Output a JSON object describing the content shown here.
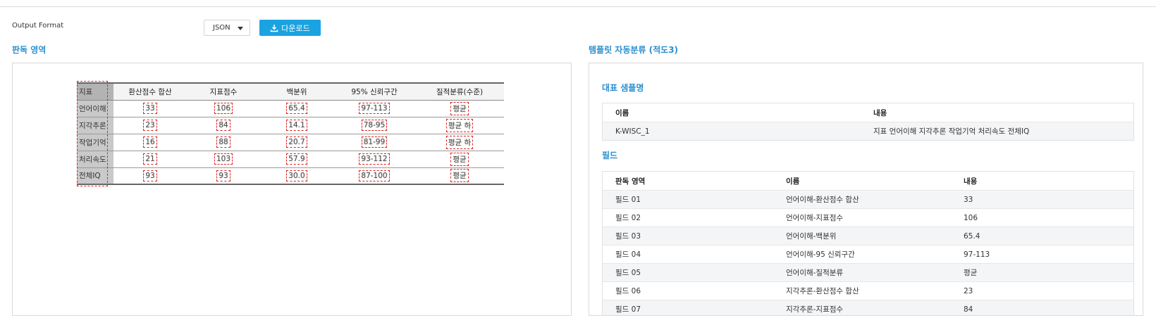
{
  "toolbar": {
    "format_label": "Output Format",
    "format_value": "JSON",
    "download_label": "다운로드"
  },
  "left_panel": {
    "title": "판독 영역",
    "doc_table": {
      "headers": [
        "지표",
        "환산점수 합산",
        "지표점수",
        "백분위",
        "95%  신뢰구간",
        "질적분류(수준)"
      ],
      "rows": [
        [
          "언어이해",
          "33",
          "106",
          "65.4",
          "97-113",
          "평균"
        ],
        [
          "지각추론",
          "23",
          "84",
          "14.1",
          "78-95",
          "평균 하"
        ],
        [
          "작업기억",
          "16",
          "88",
          "20.7",
          "81-99",
          "평균 하"
        ],
        [
          "처리속도",
          "21",
          "103",
          "57.9",
          "93-112",
          "평균"
        ],
        [
          "전체IQ",
          "93",
          "93",
          "30.0",
          "87-100",
          "평균"
        ]
      ]
    }
  },
  "right_panel": {
    "title": "템플릿 자동분류 (적도3)",
    "sample_title": "대표 샘플명",
    "sample_table": {
      "headers": [
        "이름",
        "내용"
      ],
      "rows": [
        [
          "K-WISC_1",
          "지표 언어이해 지각추론 작업기억 처리속도 전체IQ"
        ]
      ]
    },
    "fields_title": "필드",
    "fields_table": {
      "headers": [
        "판독 영역",
        "이름",
        "내용"
      ],
      "rows": [
        [
          "필드 01",
          "언어이해-환산점수 합산",
          "33"
        ],
        [
          "필드 02",
          "언어이해-지표점수",
          "106"
        ],
        [
          "필드 03",
          "언어이해-백분위",
          "65.4"
        ],
        [
          "필드 04",
          "언어이해-95 신뢰구간",
          "97-113"
        ],
        [
          "필드 05",
          "언어이해-질적분류",
          "평균"
        ],
        [
          "필드 06",
          "지각추론-환산점수 합산",
          "23"
        ],
        [
          "필드 07",
          "지각추론-지표점수",
          "84"
        ]
      ]
    }
  },
  "icons": {
    "download": "download-icon",
    "dropdown": "chevron-down-icon"
  },
  "colors": {
    "accent": "#1aa3e0",
    "title": "#2a8fcf",
    "highlight": "#e02020"
  }
}
